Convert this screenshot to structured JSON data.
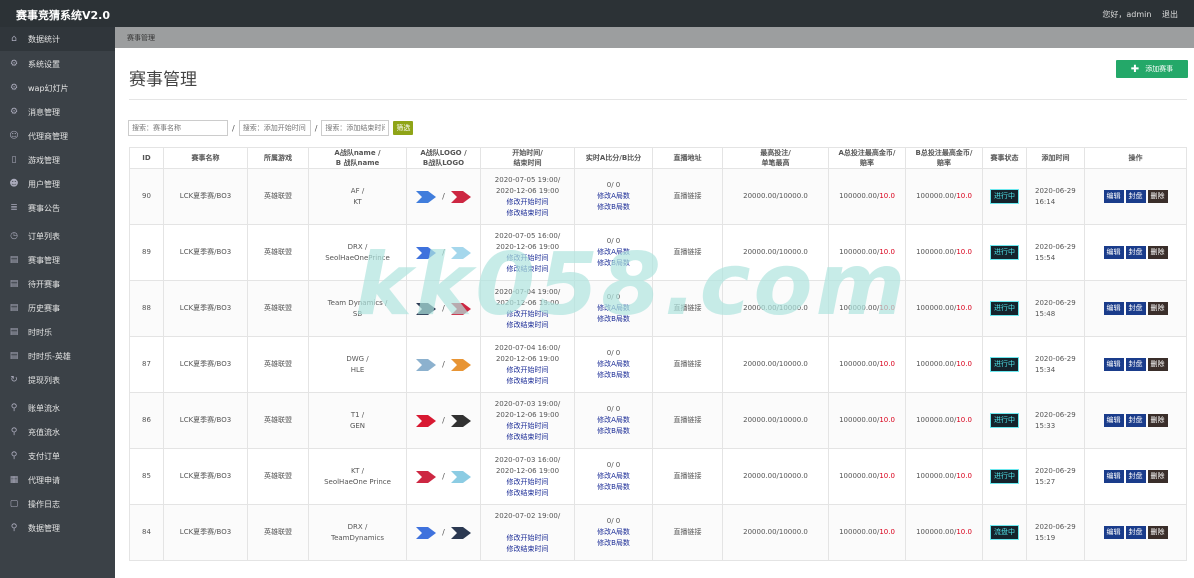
{
  "app": {
    "title": "赛事竞猜系统V2.0",
    "greeting": "您好，admin",
    "logout": "退出"
  },
  "sidebar": {
    "items": [
      {
        "label": "数据统计",
        "icon": "home-icon"
      },
      {
        "label": "系统设置",
        "icon": "gear-icon"
      },
      {
        "label": "wap幻灯片",
        "icon": "gear-icon"
      },
      {
        "label": "消息管理",
        "icon": "gear-icon"
      },
      {
        "label": "代理商管理",
        "icon": "user-icon"
      },
      {
        "label": "游戏管理",
        "icon": "document-icon"
      },
      {
        "label": "用户管理",
        "icon": "users-icon"
      },
      {
        "label": "赛事公告",
        "icon": "list-icon"
      },
      {
        "label": "订单列表",
        "icon": "clock-icon"
      },
      {
        "label": "赛事管理",
        "icon": "edit-icon"
      },
      {
        "label": "待开赛事",
        "icon": "edit-icon"
      },
      {
        "label": "历史赛事",
        "icon": "edit-icon"
      },
      {
        "label": "时时乐",
        "icon": "edit-icon"
      },
      {
        "label": "时时乐-英雄",
        "icon": "edit-icon"
      },
      {
        "label": "提现列表",
        "icon": "refresh-icon"
      },
      {
        "label": "账单流水",
        "icon": "link-icon"
      },
      {
        "label": "充值流水",
        "icon": "link-icon"
      },
      {
        "label": "支付订单",
        "icon": "link-icon"
      },
      {
        "label": "代理申请",
        "icon": "grid-icon"
      },
      {
        "label": "操作日志",
        "icon": "file-icon"
      },
      {
        "label": "数据管理",
        "icon": "link-icon"
      }
    ]
  },
  "breadcrumb": "赛事管理",
  "page": {
    "title": "赛事管理",
    "add_button": "添加赛事"
  },
  "filters": {
    "name_placeholder": "搜索：赛事名称",
    "start_placeholder": "搜索：添加开始时间",
    "end_placeholder": "搜索：添加结束时间",
    "button": "筛选",
    "separator": "/"
  },
  "table": {
    "headers": {
      "id": "ID",
      "name": "赛事名称",
      "game": "所属游戏",
      "teams_1": "A战队name /",
      "teams_2": "B 战队name",
      "logo_1": "A战队LOGO /",
      "logo_2": "B战队LOGO",
      "time_1": "开始时间/",
      "time_2": "结束时间",
      "score": "实时A比分/B比分",
      "stream": "直播地址",
      "limit_1": "最高投注/",
      "limit_2": "单笔最高",
      "a_total_1": "A总投注最高金币/",
      "a_total_2": "赔率",
      "b_total_1": "B总投注最高金币/",
      "b_total_2": "赔率",
      "status": "赛事状态",
      "added": "添加时间",
      "ops": "操作"
    },
    "link_edit_start": "修改开始时间",
    "link_edit_end": "修改结束时间",
    "link_edit_a": "修改A局数",
    "link_edit_b": "修改B局数",
    "op_edit": "编辑",
    "op_seal": "封盘",
    "op_delete": "删除",
    "rows": [
      {
        "id": "90",
        "name": "LCK夏季赛/BO3",
        "game": "英雄联盟",
        "team_a": "AF /",
        "team_b": "KT",
        "logo_a_color": "#2b6fd8",
        "logo_b_color": "#c8102e",
        "start": "2020-07-05 19:00/",
        "end": "2020-12-06 19:00",
        "score": "0/ 0",
        "stream": "直播链接",
        "limit": "20000.00/10000.0",
        "a_total": "100000.00/",
        "a_odds": "10.0",
        "b_total": "100000.00/",
        "b_odds": "10.0",
        "status": "进行中",
        "added_date": "2020-06-29",
        "added_time": "16:14"
      },
      {
        "id": "89",
        "name": "LCK夏季赛/BO3",
        "game": "英雄联盟",
        "team_a": "DRX /",
        "team_b": "SeolHaeOnePrince",
        "logo_a_color": "#2a63d9",
        "logo_b_color": "#9bd3ea",
        "start": "2020-07-05 16:00/",
        "end": "2020-12-06 19:00",
        "score": "0/ 0",
        "stream": "直播链接",
        "limit": "20000.00/10000.0",
        "a_total": "100000.00/",
        "a_odds": "10.0",
        "b_total": "100000.00/",
        "b_odds": "10.0",
        "status": "进行中",
        "added_date": "2020-06-29",
        "added_time": "15:54"
      },
      {
        "id": "88",
        "name": "LCK夏季赛/BO3",
        "game": "英雄联盟",
        "team_a": "Team Dynamics /",
        "team_b": "SB",
        "logo_a_color": "#14233f",
        "logo_b_color": "#c8102e",
        "start": "2020-07-04 19:00/",
        "end": "2020-12-06 19:00",
        "score": "0/ 0",
        "stream": "直播链接",
        "limit": "20000.00/10000.0",
        "a_total": "100000.00/",
        "a_odds": "10.0",
        "b_total": "100000.00/",
        "b_odds": "10.0",
        "status": "进行中",
        "added_date": "2020-06-29",
        "added_time": "15:48"
      },
      {
        "id": "87",
        "name": "LCK夏季赛/BO3",
        "game": "英雄联盟",
        "team_a": "DWG /",
        "team_b": "HLE",
        "logo_a_color": "#7fa9c9",
        "logo_b_color": "#e58a1f",
        "start": "2020-07-04 16:00/",
        "end": "2020-12-06 19:00",
        "score": "0/ 0",
        "stream": "直播链接",
        "limit": "20000.00/10000.0",
        "a_total": "100000.00/",
        "a_odds": "10.0",
        "b_total": "100000.00/",
        "b_odds": "10.0",
        "status": "进行中",
        "added_date": "2020-06-29",
        "added_time": "15:34"
      },
      {
        "id": "86",
        "name": "LCK夏季赛/BO3",
        "game": "英雄联盟",
        "team_a": "T1 /",
        "team_b": "GEN",
        "logo_a_color": "#d4001c",
        "logo_b_color": "#1c1c1c",
        "start": "2020-07-03 19:00/",
        "end": "2020-12-06 19:00",
        "score": "0/ 0",
        "stream": "直播链接",
        "limit": "20000.00/10000.0",
        "a_total": "100000.00/",
        "a_odds": "10.0",
        "b_total": "100000.00/",
        "b_odds": "10.0",
        "status": "进行中",
        "added_date": "2020-06-29",
        "added_time": "15:33"
      },
      {
        "id": "85",
        "name": "LCK夏季赛/BO3",
        "game": "英雄联盟",
        "team_a": "KT /",
        "team_b": "SeolHaeOne Prince",
        "logo_a_color": "#c8102e",
        "logo_b_color": "#7fc6e0",
        "start": "2020-07-03 16:00/",
        "end": "2020-12-06 19:00",
        "score": "0/ 0",
        "stream": "直播链接",
        "limit": "20000.00/10000.0",
        "a_total": "100000.00/",
        "a_odds": "10.0",
        "b_total": "100000.00/",
        "b_odds": "10.0",
        "status": "进行中",
        "added_date": "2020-06-29",
        "added_time": "15:27"
      },
      {
        "id": "84",
        "name": "LCK夏季赛/BO3",
        "game": "英雄联盟",
        "team_a": "DRX /",
        "team_b": "TeamDynamics",
        "logo_a_color": "#2a63d9",
        "logo_b_color": "#14233f",
        "start": "2020-07-02 19:00/",
        "end": "",
        "score": "0/ 0",
        "stream": "直播链接",
        "limit": "20000.00/10000.0",
        "a_total": "100000.00/",
        "a_odds": "10.0",
        "b_total": "100000.00/",
        "b_odds": "10.0",
        "status": "流盘中",
        "added_date": "2020-06-29",
        "added_time": "15:19"
      }
    ]
  },
  "watermark": "kk058.com"
}
